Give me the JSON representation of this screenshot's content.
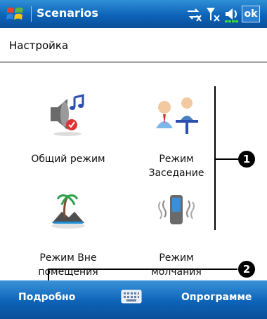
{
  "titlebar": {
    "title": "Scenarios",
    "ok_label": "ok"
  },
  "subheader": {
    "title": "Настройка"
  },
  "items": [
    {
      "line1": "Общий режим",
      "line2": "",
      "icon": "speaker-music-icon"
    },
    {
      "line1": "Режим",
      "line2": "Заседание",
      "icon": "meeting-icon"
    },
    {
      "line1": "Режим Вне",
      "line2": "помещения",
      "icon": "outdoor-icon"
    },
    {
      "line1": "Режим",
      "line2": "молчания",
      "icon": "vibrate-phone-icon"
    }
  ],
  "callouts": {
    "one": "1",
    "two": "2"
  },
  "bottombar": {
    "left_label": "Подробно",
    "right_label": "Опрограмме",
    "keyboard_icon": "keyboard-icon"
  }
}
